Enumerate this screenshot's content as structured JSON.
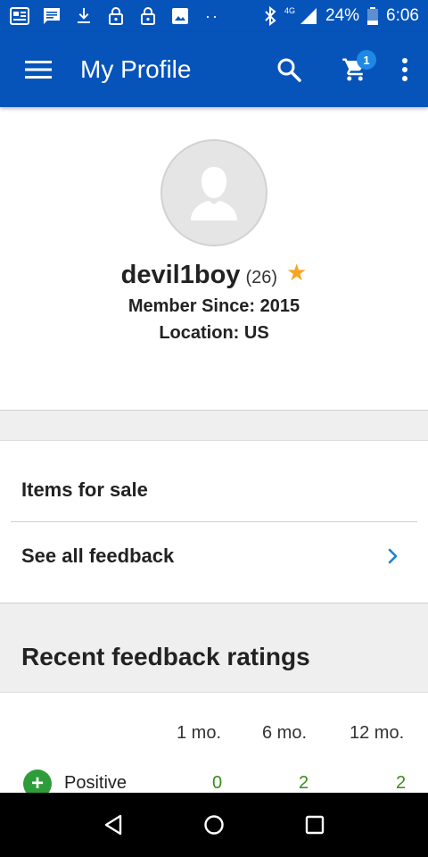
{
  "status_bar": {
    "battery": "24%",
    "time": "6:06",
    "network": "4G"
  },
  "app_bar": {
    "title": "My Profile",
    "cart_count": "1"
  },
  "profile": {
    "username": "devil1boy",
    "feedback_count": "(26)",
    "member_since": "Member Since: 2015",
    "location": "Location: US"
  },
  "links": {
    "items_for_sale": "Items for sale",
    "see_all_feedback": "See all feedback"
  },
  "feedback": {
    "section_title": "Recent feedback ratings",
    "columns": [
      "1 mo.",
      "6 mo.",
      "12 mo."
    ],
    "positive": {
      "label": "Positive",
      "values": [
        "0",
        "2",
        "2"
      ]
    }
  },
  "colors": {
    "brand_blue": "#0654ba",
    "badge_blue": "#1e88e5",
    "star": "#f5a623",
    "positive_green": "#2e9c3a"
  }
}
